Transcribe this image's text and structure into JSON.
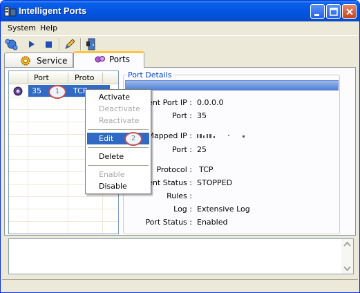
{
  "window": {
    "title": "Intelligent Ports"
  },
  "menubar": {
    "items": [
      "System",
      "Help"
    ]
  },
  "toolbar": {
    "icons": [
      "network-icon",
      "play-icon",
      "stop-icon",
      "edit-pencil-icon",
      "exit-door-icon"
    ]
  },
  "tabs": [
    {
      "label": "Service",
      "active": false
    },
    {
      "label": "Ports",
      "active": true
    }
  ],
  "ports_list": {
    "columns": [
      "Port",
      "Proto"
    ],
    "rows": [
      {
        "port": "35",
        "proto": "TCP"
      }
    ]
  },
  "port_details": {
    "title": "Port Details",
    "fields": [
      {
        "label": "igent Port IP :",
        "value": "0.0.0.0"
      },
      {
        "label": "Port :",
        "value": "35"
      },
      {
        "label": "Mapped IP :",
        "value": ""
      },
      {
        "label": "Port :",
        "value": "25"
      },
      {
        "label": "Protocol :",
        "value": "TCP"
      },
      {
        "label": "rrent Status :",
        "value": "STOPPED"
      },
      {
        "label": "Rules :",
        "value": ""
      },
      {
        "label": "Log :",
        "value": "Extensive Log"
      },
      {
        "label": "Port Status :",
        "value": "Enabled"
      }
    ]
  },
  "context_menu": {
    "items": [
      {
        "label": "Activate",
        "enabled": true
      },
      {
        "label": "Deactivate",
        "enabled": false
      },
      {
        "label": "Reactivate",
        "enabled": false
      },
      {
        "label": "Edit",
        "enabled": true,
        "selected": true
      },
      {
        "label": "Delete",
        "enabled": true
      },
      {
        "label": "Enable",
        "enabled": false
      },
      {
        "label": "Disable",
        "enabled": true
      }
    ]
  },
  "markers": [
    "1",
    "2"
  ],
  "colors": {
    "selection": "#316ac5",
    "titlebar": "#0456e2",
    "tab_highlight": "#ffc83c",
    "marker": "#c0504d"
  }
}
